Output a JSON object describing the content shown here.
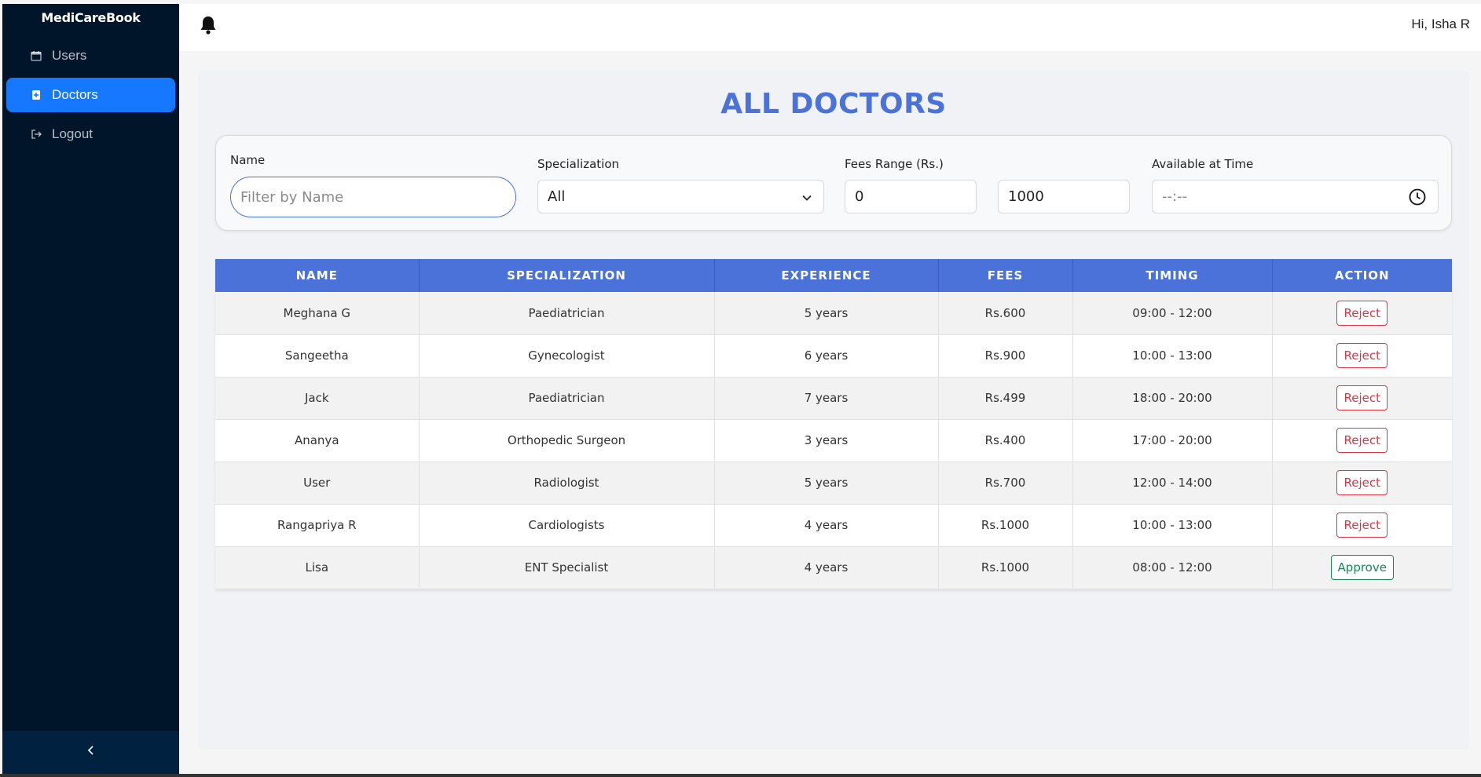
{
  "app": {
    "title": "MediCareBook"
  },
  "sidebar": {
    "items": [
      {
        "label": "Users",
        "icon": "calendar-icon",
        "active": false
      },
      {
        "label": "Doctors",
        "icon": "medical-icon",
        "active": true
      },
      {
        "label": "Logout",
        "icon": "logout-icon",
        "active": false
      }
    ],
    "collapse_icon": "chevron-left-icon"
  },
  "header": {
    "greeting": "Hi, Isha R",
    "notification_icon": "bell-icon"
  },
  "main": {
    "title": "ALL DOCTORS"
  },
  "filters": {
    "name": {
      "label": "Name",
      "placeholder": "Filter by Name",
      "value": ""
    },
    "specialization": {
      "label": "Specialization",
      "value": "All"
    },
    "fees": {
      "label": "Fees Range (Rs.)",
      "min": "0",
      "max": "1000"
    },
    "time": {
      "label": "Available at Time",
      "placeholder": "--:--"
    }
  },
  "table": {
    "columns": [
      "NAME",
      "SPECIALIZATION",
      "EXPERIENCE",
      "FEES",
      "TIMING",
      "ACTION"
    ],
    "rows": [
      {
        "name": "Meghana G",
        "specialization": "Paediatrician",
        "experience": "5 years",
        "fees": "Rs.600",
        "timing": "09:00 - 12:00",
        "action": "Reject"
      },
      {
        "name": "Sangeetha",
        "specialization": "Gynecologist",
        "experience": "6 years",
        "fees": "Rs.900",
        "timing": "10:00 - 13:00",
        "action": "Reject"
      },
      {
        "name": "Jack",
        "specialization": "Paediatrician",
        "experience": "7 years",
        "fees": "Rs.499",
        "timing": "18:00 - 20:00",
        "action": "Reject"
      },
      {
        "name": "Ananya",
        "specialization": "Orthopedic Surgeon",
        "experience": "3 years",
        "fees": "Rs.400",
        "timing": "17:00 - 20:00",
        "action": "Reject"
      },
      {
        "name": "User",
        "specialization": "Radiologist",
        "experience": "5 years",
        "fees": "Rs.700",
        "timing": "12:00 - 14:00",
        "action": "Reject"
      },
      {
        "name": "Rangapriya R",
        "specialization": "Cardiologists",
        "experience": "4 years",
        "fees": "Rs.1000",
        "timing": "10:00 - 13:00",
        "action": "Reject"
      },
      {
        "name": "Lisa",
        "specialization": "ENT Specialist",
        "experience": "4 years",
        "fees": "Rs.1000",
        "timing": "08:00 - 12:00",
        "action": "Approve"
      }
    ]
  },
  "colors": {
    "sidebar": "#001529",
    "active": "#1677ff",
    "accent": "#4a72d9",
    "reject": "#dc3545",
    "approve": "#198754"
  }
}
